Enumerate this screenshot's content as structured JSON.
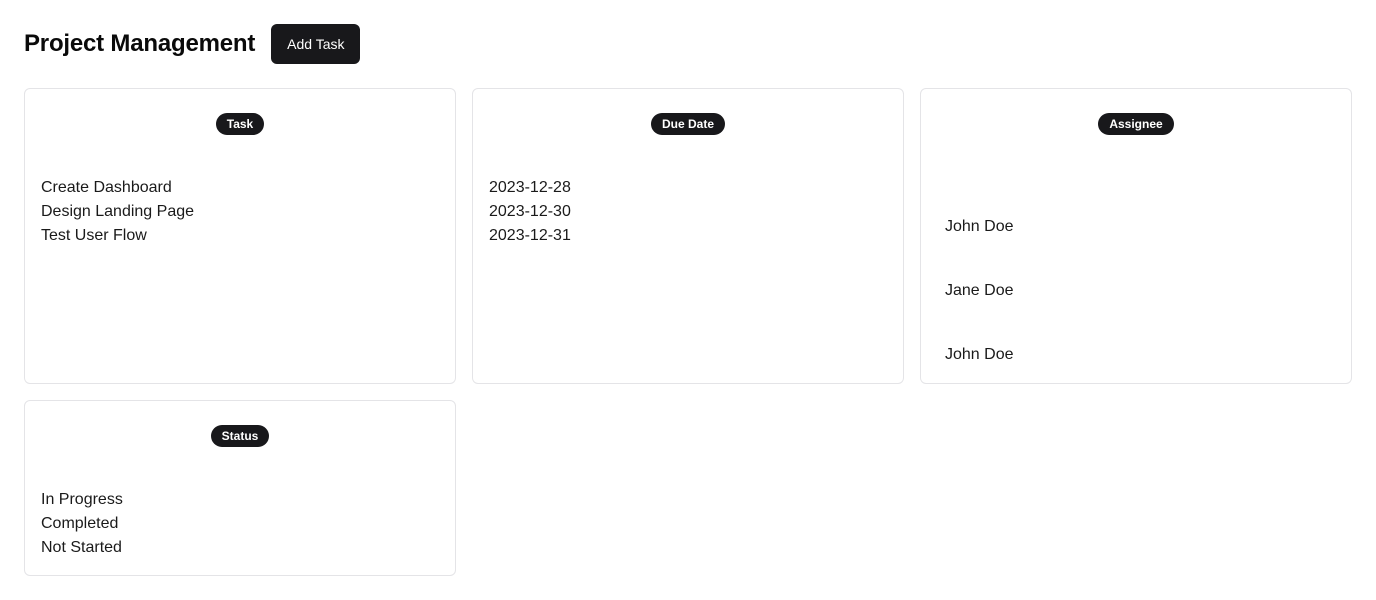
{
  "header": {
    "title": "Project Management",
    "add_button_label": "Add Task"
  },
  "columns": {
    "task": {
      "label": "Task",
      "items": [
        "Create Dashboard",
        "Design Landing Page",
        "Test User Flow"
      ]
    },
    "due_date": {
      "label": "Due Date",
      "items": [
        "2023-12-28",
        "2023-12-30",
        "2023-12-31"
      ]
    },
    "assignee": {
      "label": "Assignee",
      "items": [
        "John Doe",
        "Jane Doe",
        "John Doe"
      ]
    },
    "status": {
      "label": "Status",
      "items": [
        "In Progress",
        "Completed",
        "Not Started"
      ]
    }
  },
  "colors": {
    "accent": "#18181b",
    "card_border": "#e4e4e7",
    "text": "#1a1a1a"
  }
}
